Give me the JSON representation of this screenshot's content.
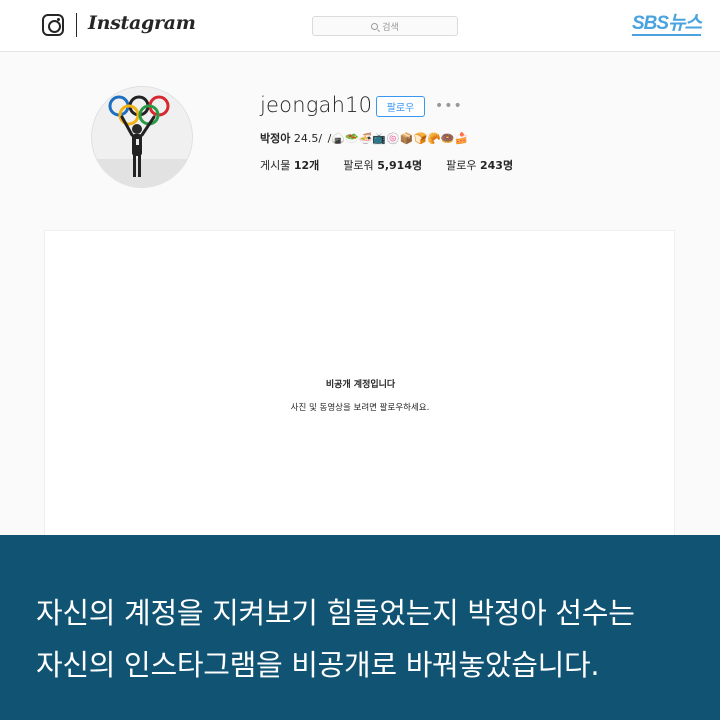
{
  "nav": {
    "wordmark": "Instagram",
    "search_placeholder": "검색",
    "news_logo": "SBS뉴스",
    "icons": [
      "instagram-glyph-icon",
      "search-icon"
    ]
  },
  "profile": {
    "username": "jeongah10",
    "follow_label": "팔로우",
    "more_label": "•••",
    "bio_name": "박정아",
    "bio_rest": " 24.5/ /🍙🥗🍜📺🍥📦🍞🥐🍩🍰",
    "stats": {
      "posts_label": "게시물",
      "posts_value": "12개",
      "followers_label": "팔로워",
      "followers_value": "5,914명",
      "following_label": "팔로우",
      "following_value": "243명"
    }
  },
  "private_notice": {
    "title": "비공개 계정입니다",
    "description": "사진 및 동영상을 보려면 팔로우하세요."
  },
  "caption": {
    "line1": "자신의 계정을 지켜보기 힘들었는지 박정아 선수는",
    "line2": "자신의 인스타그램을 비공개로 바꿔놓았습니다."
  },
  "colors": {
    "accent": "#3897f0",
    "caption_bg": "#105373",
    "news_logo": "#4aa3df"
  }
}
